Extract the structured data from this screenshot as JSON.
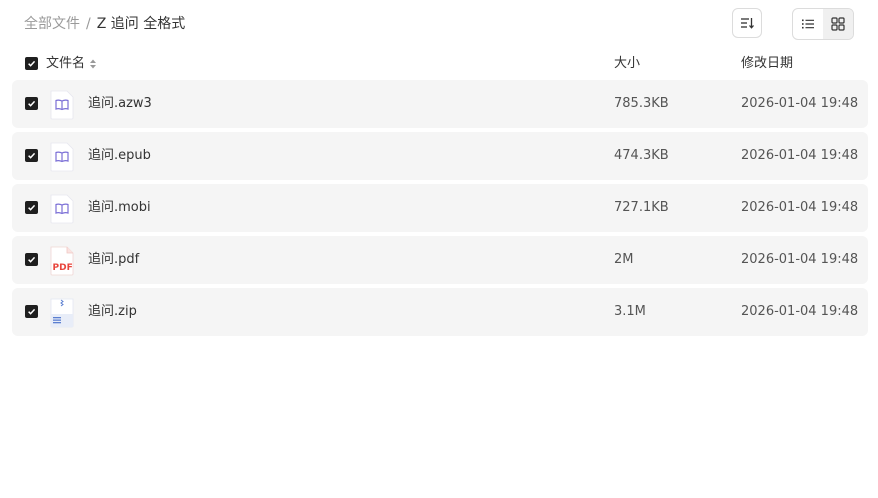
{
  "breadcrumb": {
    "root": "全部文件",
    "separator": "/",
    "current": "Z 追问 全格式"
  },
  "toolbar": {
    "sort_icon": "sort-icon",
    "list_view_icon": "list-view-icon",
    "grid_view_icon": "grid-view-icon",
    "active_view": "list"
  },
  "table": {
    "headers": {
      "name": "文件名",
      "size": "大小",
      "modified": "修改日期"
    },
    "rows": [
      {
        "name": "追问.azw3",
        "size": "785.3KB",
        "modified": "2026-01-04 19:48",
        "icon": "ebook-icon",
        "checked": true
      },
      {
        "name": "追问.epub",
        "size": "474.3KB",
        "modified": "2026-01-04 19:48",
        "icon": "ebook-icon",
        "checked": true
      },
      {
        "name": "追问.mobi",
        "size": "727.1KB",
        "modified": "2026-01-04 19:48",
        "icon": "ebook-icon",
        "checked": true
      },
      {
        "name": "追问.pdf",
        "size": "2M",
        "modified": "2026-01-04 19:48",
        "icon": "pdf-icon",
        "checked": true
      },
      {
        "name": "追问.zip",
        "size": "3.1M",
        "modified": "2026-01-04 19:48",
        "icon": "zip-icon",
        "checked": true
      }
    ]
  },
  "icons": {
    "pdf_label": "PDF"
  },
  "colors": {
    "checkbox": "#1f1f1f",
    "row_background": "#f5f5f5",
    "ebook_accent": "#7b6fd6",
    "pdf_accent": "#e8453c",
    "zip_accent": "#5b7fd1"
  }
}
